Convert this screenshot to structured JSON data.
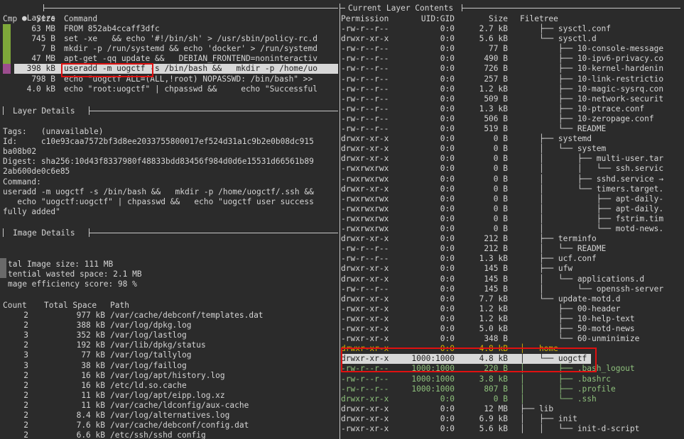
{
  "layers_panel": {
    "title": "Layers",
    "bullet": "●",
    "columns": {
      "cmp": "Cmp",
      "size": "Size",
      "command": "Command"
    },
    "rows": [
      {
        "size": "63 MB",
        "command": "FROM 852ab4ccaff3dfc",
        "bar_color": "#7ea83a"
      },
      {
        "size": "745 B",
        "command": "set -xe   && echo '#!/bin/sh' > /usr/sbin/policy-rc.d",
        "bar_color": "#7ea83a"
      },
      {
        "size": "7 B",
        "command": "mkdir -p /run/systemd && echo 'docker' > /run/systemd",
        "bar_color": "#7ea83a"
      },
      {
        "size": "47 MB",
        "command": "apt-get -qq update &&   DEBIAN_FRONTEND=noninteractiv",
        "bar_color": "#7ea83a"
      },
      {
        "size": "398 kB",
        "command": "useradd -m uogctf -s /bin/bash &&   mkdir -p /home/uo",
        "bar_color": "#9c4d8f",
        "selected": true
      },
      {
        "size": "798 B",
        "command": "echo \"uogctf ALL=(ALL,!root) NOPASSWD: /bin/bash\" >>",
        "bar_color": ""
      },
      {
        "size": "4.0 kB",
        "command": "echo \"root:uogctf\" | chpasswd &&     echo \"Successful",
        "bar_color": ""
      }
    ]
  },
  "layer_details": {
    "title": "Layer Details",
    "lines": [
      "Tags:   (unavailable)",
      "Id:     c10e93caa7572bf3d8ee2033755800017ef524d31a1c9b2e0b08dc915",
      "ba08b02",
      "Digest: sha256:10d43f8337980f48833bdd83456f984d0d6e15531d66561b89",
      "2ab600de0c6e85",
      "Command:",
      "useradd -m uogctf -s /bin/bash &&   mkdir -p /home/uogctf/.ssh &&",
      "   echo \"uogctf:uogctf\" | chpasswd &&   echo \"uogctf user success",
      "fully added\""
    ]
  },
  "image_details": {
    "title": "Image Details",
    "summary": [
      "tal Image size: 111 MB",
      "tential wasted space: 2.1 MB",
      "mage efficiency score: 98 %"
    ],
    "columns": {
      "count": "Count",
      "total_space": "Total Space",
      "path": "Path"
    },
    "rows": [
      {
        "count": "2",
        "space": "977 kB",
        "path": "/var/cache/debconf/templates.dat"
      },
      {
        "count": "2",
        "space": "388 kB",
        "path": "/var/log/dpkg.log"
      },
      {
        "count": "3",
        "space": "352 kB",
        "path": "/var/log/lastlog"
      },
      {
        "count": "2",
        "space": "192 kB",
        "path": "/var/lib/dpkg/status"
      },
      {
        "count": "3",
        "space": "77 kB",
        "path": "/var/log/tallylog"
      },
      {
        "count": "3",
        "space": "38 kB",
        "path": "/var/log/faillog"
      },
      {
        "count": "2",
        "space": "16 kB",
        "path": "/var/log/apt/history.log"
      },
      {
        "count": "2",
        "space": "16 kB",
        "path": "/etc/ld.so.cache"
      },
      {
        "count": "2",
        "space": "11 kB",
        "path": "/var/log/apt/eipp.log.xz"
      },
      {
        "count": "2",
        "space": "11 kB",
        "path": "/var/cache/ldconfig/aux-cache"
      },
      {
        "count": "2",
        "space": "8.4 kB",
        "path": "/var/log/alternatives.log"
      },
      {
        "count": "2",
        "space": "7.6 kB",
        "path": "/var/cache/debconf/config.dat"
      },
      {
        "count": "2",
        "space": "6.6 kB",
        "path": "/etc/ssh/sshd_config"
      }
    ]
  },
  "contents_panel": {
    "title": "Current Layer Contents",
    "columns": {
      "permission": "Permission",
      "uidgid": "UID:GID",
      "size": "Size",
      "filetree": "Filetree"
    },
    "rows": [
      {
        "perm": "-rw-r--r--",
        "ug": "0:0",
        "size": "2.7 kB",
        "tree": "    ├── sysctl.conf",
        "style": ""
      },
      {
        "perm": "drwxr-xr-x",
        "ug": "0:0",
        "size": "5.6 kB",
        "tree": "    └── sysctl.d",
        "style": ""
      },
      {
        "perm": "-rw-r--r--",
        "ug": "0:0",
        "size": "77 B",
        "tree": "        ├── 10-console-message",
        "style": ""
      },
      {
        "perm": "-rw-r--r--",
        "ug": "0:0",
        "size": "490 B",
        "tree": "        ├── 10-ipv6-privacy.co",
        "style": ""
      },
      {
        "perm": "-rw-r--r--",
        "ug": "0:0",
        "size": "726 B",
        "tree": "        ├── 10-kernel-hardenin",
        "style": ""
      },
      {
        "perm": "-rw-r--r--",
        "ug": "0:0",
        "size": "257 B",
        "tree": "        ├── 10-link-restrictio",
        "style": ""
      },
      {
        "perm": "-rw-r--r--",
        "ug": "0:0",
        "size": "1.2 kB",
        "tree": "        ├── 10-magic-sysrq.con",
        "style": ""
      },
      {
        "perm": "-rw-r--r--",
        "ug": "0:0",
        "size": "509 B",
        "tree": "        ├── 10-network-securit",
        "style": ""
      },
      {
        "perm": "-rw-r--r--",
        "ug": "0:0",
        "size": "1.3 kB",
        "tree": "        ├── 10-ptrace.conf",
        "style": ""
      },
      {
        "perm": "-rw-r--r--",
        "ug": "0:0",
        "size": "506 B",
        "tree": "        ├── 10-zeropage.conf",
        "style": ""
      },
      {
        "perm": "-rw-r--r--",
        "ug": "0:0",
        "size": "519 B",
        "tree": "        └── README",
        "style": ""
      },
      {
        "perm": "drwxr-xr-x",
        "ug": "0:0",
        "size": "0 B",
        "tree": "    ├── systemd",
        "style": ""
      },
      {
        "perm": "drwxr-xr-x",
        "ug": "0:0",
        "size": "0 B",
        "tree": "    │   └── system",
        "style": ""
      },
      {
        "perm": "drwxr-xr-x",
        "ug": "0:0",
        "size": "0 B",
        "tree": "    │       ├── multi-user.tar",
        "style": ""
      },
      {
        "perm": "-rwxrwxrwx",
        "ug": "0:0",
        "size": "0 B",
        "tree": "    │       │   └── ssh.servic",
        "style": ""
      },
      {
        "perm": "-rwxrwxrwx",
        "ug": "0:0",
        "size": "0 B",
        "tree": "    │       ├── sshd.service →",
        "style": ""
      },
      {
        "perm": "drwxr-xr-x",
        "ug": "0:0",
        "size": "0 B",
        "tree": "    │       └── timers.target.",
        "style": ""
      },
      {
        "perm": "-rwxrwxrwx",
        "ug": "0:0",
        "size": "0 B",
        "tree": "    │           ├── apt-daily-",
        "style": ""
      },
      {
        "perm": "-rwxrwxrwx",
        "ug": "0:0",
        "size": "0 B",
        "tree": "    │           ├── apt-daily.",
        "style": ""
      },
      {
        "perm": "-rwxrwxrwx",
        "ug": "0:0",
        "size": "0 B",
        "tree": "    │           ├── fstrim.tim",
        "style": ""
      },
      {
        "perm": "-rwxrwxrwx",
        "ug": "0:0",
        "size": "0 B",
        "tree": "    │           └── motd-news.",
        "style": ""
      },
      {
        "perm": "drwxr-xr-x",
        "ug": "0:0",
        "size": "212 B",
        "tree": "    ├── terminfo",
        "style": ""
      },
      {
        "perm": "-rw-r--r--",
        "ug": "0:0",
        "size": "212 B",
        "tree": "    │   └── README",
        "style": ""
      },
      {
        "perm": "-rw-r--r--",
        "ug": "0:0",
        "size": "1.3 kB",
        "tree": "    ├── ucf.conf",
        "style": ""
      },
      {
        "perm": "drwxr-xr-x",
        "ug": "0:0",
        "size": "145 B",
        "tree": "    ├── ufw",
        "style": ""
      },
      {
        "perm": "drwxr-xr-x",
        "ug": "0:0",
        "size": "145 B",
        "tree": "    │   └── applications.d",
        "style": ""
      },
      {
        "perm": "-rw-r--r--",
        "ug": "0:0",
        "size": "145 B",
        "tree": "    │       └── openssh-server",
        "style": ""
      },
      {
        "perm": "drwxr-xr-x",
        "ug": "0:0",
        "size": "7.7 kB",
        "tree": "    └── update-motd.d",
        "style": ""
      },
      {
        "perm": "-rwxr-xr-x",
        "ug": "0:0",
        "size": "1.2 kB",
        "tree": "        ├── 00-header",
        "style": ""
      },
      {
        "perm": "-rwxr-xr-x",
        "ug": "0:0",
        "size": "1.2 kB",
        "tree": "        ├── 10-help-text",
        "style": ""
      },
      {
        "perm": "-rwxr-xr-x",
        "ug": "0:0",
        "size": "5.0 kB",
        "tree": "        ├── 50-motd-news",
        "style": ""
      },
      {
        "perm": "-rwxr-xr-x",
        "ug": "0:0",
        "size": "348 B",
        "tree": "        └── 60-unminimize",
        "style": ""
      },
      {
        "perm": "drwxr-xr-x",
        "ug": "0:0",
        "size": "4.8 kB",
        "tree": "├── home",
        "style": "yellow"
      },
      {
        "perm": "drwxr-xr-x",
        "ug": "1000:1000",
        "size": "4.8 kB",
        "tree": "│   └── uogctf",
        "style": "selected"
      },
      {
        "perm": "-rw-r--r--",
        "ug": "1000:1000",
        "size": "220 B",
        "tree": "│       ├── .bash_logout",
        "style": "green"
      },
      {
        "perm": "-rw-r--r--",
        "ug": "1000:1000",
        "size": "3.8 kB",
        "tree": "│       ├── .bashrc",
        "style": "green"
      },
      {
        "perm": "-rw-r--r--",
        "ug": "1000:1000",
        "size": "807 B",
        "tree": "│       ├── .profile",
        "style": "green"
      },
      {
        "perm": "drwxr-xr-x",
        "ug": "0:0",
        "size": "0 B",
        "tree": "│       └── .ssh",
        "style": "green"
      },
      {
        "perm": "drwxr-xr-x",
        "ug": "0:0",
        "size": "12 MB",
        "tree": "├── lib",
        "style": ""
      },
      {
        "perm": "drwxr-xr-x",
        "ug": "0:0",
        "size": "6.9 kB",
        "tree": "│   ├── init",
        "style": ""
      },
      {
        "perm": "-rwxr-xr-x",
        "ug": "0:0",
        "size": "5.6 kB",
        "tree": "│   │   └── init-d-script",
        "style": ""
      }
    ]
  }
}
